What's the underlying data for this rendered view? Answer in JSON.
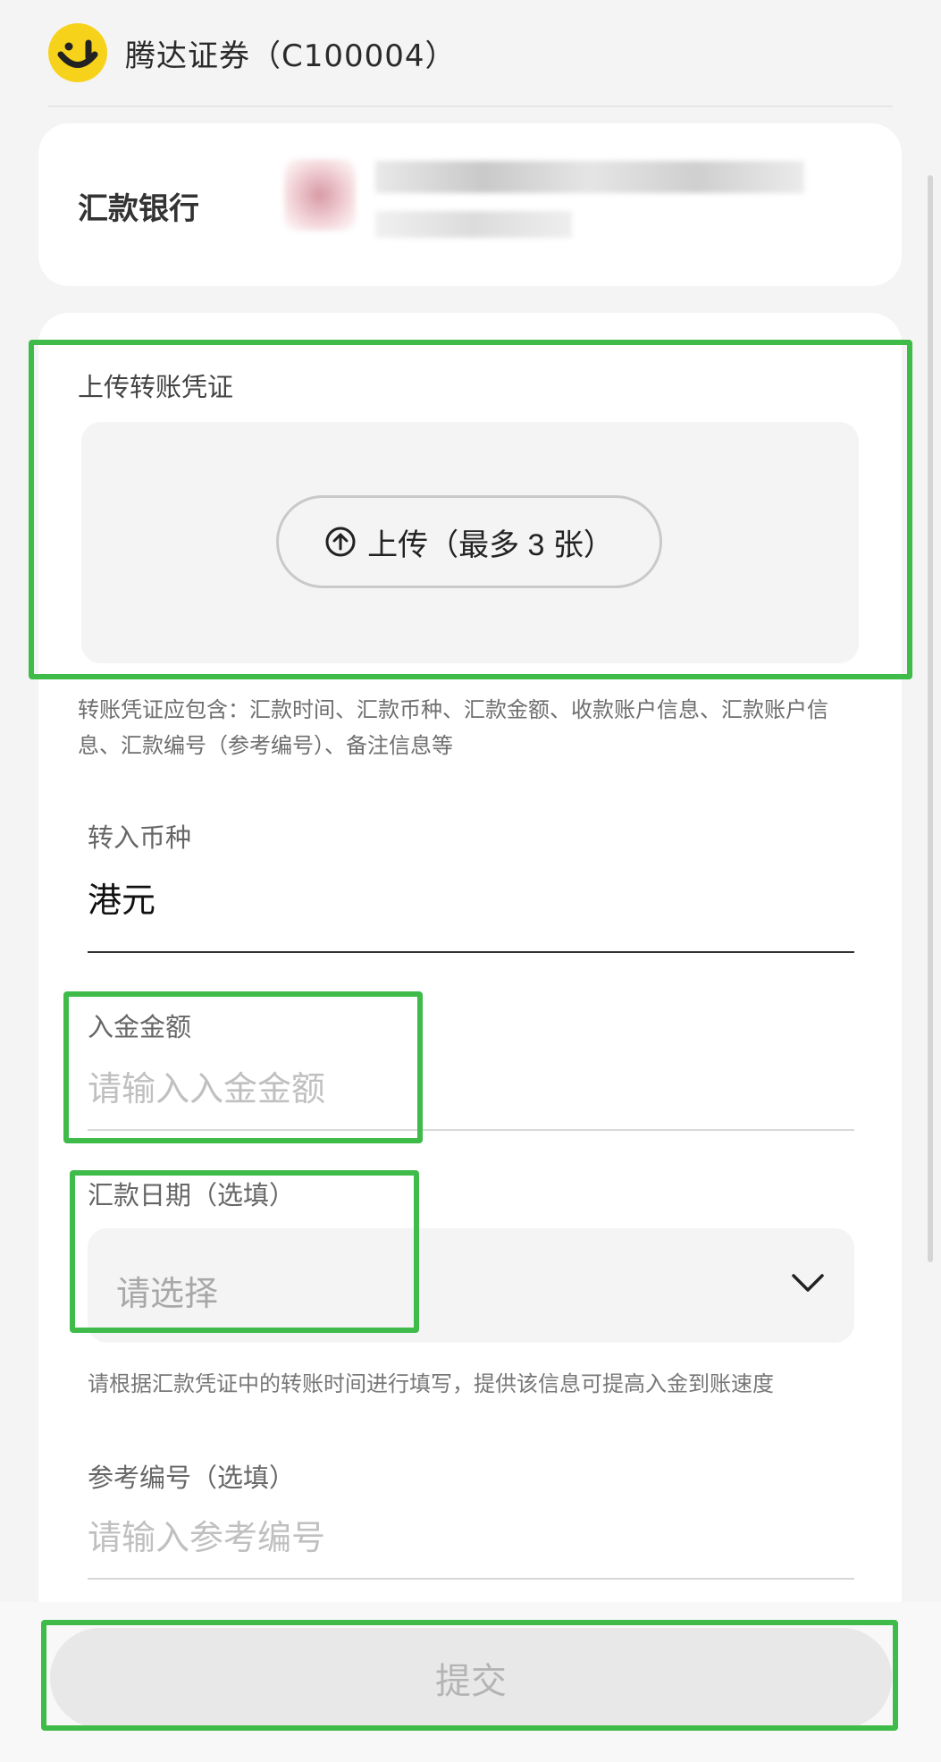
{
  "header": {
    "broker_name": "腾达证券（C100004）"
  },
  "bank": {
    "label": "汇款银行"
  },
  "upload": {
    "title": "上传转账凭证",
    "button_label": "上传（最多 3 张）",
    "hint": "转账凭证应包含：汇款时间、汇款币种、汇款金额、收款账户信息、汇款账户信息、汇款编号（参考编号）、备注信息等"
  },
  "currency": {
    "label": "转入币种",
    "value": "港元"
  },
  "amount": {
    "label": "入金金额",
    "placeholder": "请输入入金金额"
  },
  "date": {
    "label": "汇款日期（选填）",
    "placeholder": "请选择",
    "hint": "请根据汇款凭证中的转账时间进行填写，提供该信息可提高入金到账速度"
  },
  "reference": {
    "label": "参考编号（选填）",
    "placeholder": "请输入参考编号"
  },
  "submit": {
    "label": "提交"
  },
  "colors": {
    "logo": "#f7d21a",
    "highlight": "#3fbb4a",
    "submit_disabled": "#e8e8e8"
  }
}
